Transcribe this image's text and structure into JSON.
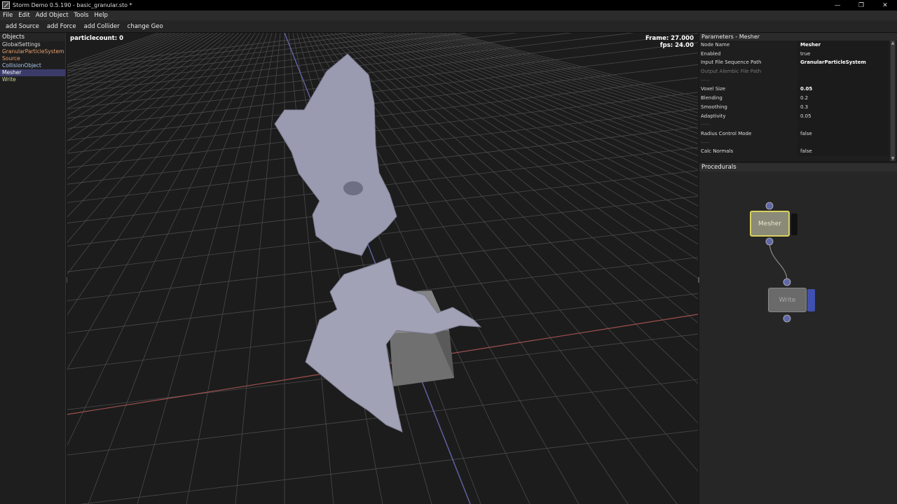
{
  "window": {
    "title": "Storm Demo 0.5.190 - basic_granular.sto *",
    "controls": [
      "—",
      "❐",
      "✕"
    ]
  },
  "menu": [
    "File",
    "Edit",
    "Add Object",
    "Tools",
    "Help"
  ],
  "toolbar": [
    "add Source",
    "add Force",
    "add Collider",
    "change Geo"
  ],
  "objects": {
    "header": "Objects",
    "items": [
      {
        "label": "GlobalSettings",
        "style": "default"
      },
      {
        "label": "GranularParticleSystem",
        "style": "orange"
      },
      {
        "label": "Source",
        "style": "orange"
      },
      {
        "label": "CollisionObject",
        "style": "blue"
      },
      {
        "label": "Mesher",
        "style": "selected"
      },
      {
        "label": "Write",
        "style": "green"
      }
    ]
  },
  "viewport": {
    "particlecount": "particlecount: 0",
    "frame": "Frame: 27.000",
    "fps": "fps: 24.00"
  },
  "parameters": {
    "header": "Parameters - Mesher",
    "rows": [
      {
        "name": "Node Name",
        "value": "Mesher",
        "bold": true
      },
      {
        "name": "Enabled",
        "value": "true"
      },
      {
        "name": "Input File Sequence Path",
        "value": "GranularParticleSystem",
        "bold": true
      },
      {
        "name": "Output Alembic File Path",
        "value": "",
        "dim": true
      },
      {
        "name": "-----",
        "value": "",
        "sep": true
      },
      {
        "name": "Voxel Size",
        "value": "0.05",
        "bold": true
      },
      {
        "name": "Blending",
        "value": "0.2"
      },
      {
        "name": "Smoothing",
        "value": "0.3"
      },
      {
        "name": "Adaptivity",
        "value": "0.05"
      },
      {
        "name": "-----",
        "value": "",
        "sep": true
      },
      {
        "name": "Radius Control Mode",
        "value": "false"
      },
      {
        "name": "-----",
        "value": "",
        "sep": true
      },
      {
        "name": "Calc Normals",
        "value": "false"
      }
    ]
  },
  "procedurals": {
    "header": "Procedurals",
    "nodes": [
      {
        "label": "Mesher"
      },
      {
        "label": "Write"
      }
    ]
  },
  "colors": {
    "selected_node_border": "#d8d060",
    "port": "#6068a8",
    "write_flag": "#4050b0"
  }
}
